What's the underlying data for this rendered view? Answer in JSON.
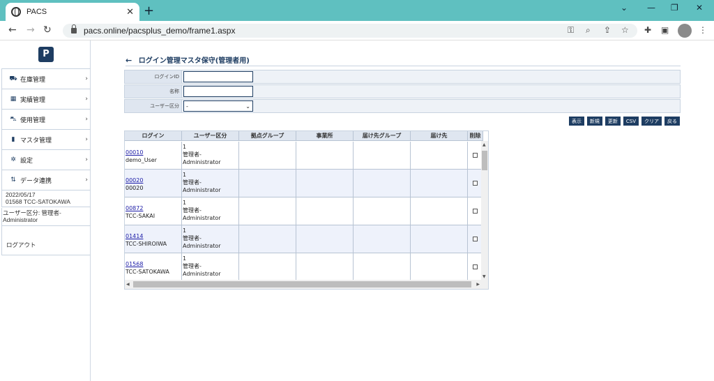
{
  "browser": {
    "tab_title": "PACS",
    "tab_close": "✕",
    "new_tab": "+",
    "url": "pacs.online/pacsplus_demo/frame1.aspx",
    "min": "⌄",
    "min2": "—",
    "restore": "❐",
    "close": "✕"
  },
  "sidebar": {
    "logo": "P",
    "items": [
      {
        "label": "在庫管理",
        "icon": "box-icon"
      },
      {
        "label": "実績管理",
        "icon": "table-icon"
      },
      {
        "label": "使用管理",
        "icon": "cart-icon"
      },
      {
        "label": "マスタ管理",
        "icon": "file-icon"
      },
      {
        "label": "設定",
        "icon": "gear-icon"
      },
      {
        "label": "データ連携",
        "icon": "sync-icon"
      }
    ],
    "date": "2022/05/17",
    "user": "01568 TCC-SATOKAWA",
    "user_type": "ユーザー区分: 管理者-Administrator",
    "logout": "ログアウト"
  },
  "page": {
    "title": "ログイン管理マスタ保守(管理者用)"
  },
  "form": {
    "login_id_label": "ログインID",
    "login_id_value": "",
    "name_label": "名称",
    "name_value": "",
    "user_type_label": "ユーザー区分",
    "user_type_value": "-"
  },
  "buttons": {
    "show": "表示",
    "new": "新規",
    "update": "更新",
    "csv": "CSV",
    "clear": "クリア",
    "back": "戻る"
  },
  "grid": {
    "headers": [
      "ログイン",
      "ユーザー区分",
      "拠点グループ",
      "事業所",
      "届け先グループ",
      "届け先",
      "削除"
    ],
    "rows": [
      {
        "id": "00010",
        "name": "demo_User",
        "type_code": "1",
        "type_name": "管理者-",
        "type_name2": "Administrator"
      },
      {
        "id": "00020",
        "name": "00020",
        "type_code": "1",
        "type_name": "管理者-",
        "type_name2": "Administrator"
      },
      {
        "id": "00872",
        "name": "TCC-SAKAI",
        "type_code": "1",
        "type_name": "管理者-",
        "type_name2": "Administrator"
      },
      {
        "id": "01414",
        "name": "TCC-SHIROIWA",
        "type_code": "1",
        "type_name": "管理者-",
        "type_name2": "Administrator"
      },
      {
        "id": "01568",
        "name": "TCC-SATOKAWA",
        "type_code": "1",
        "type_name": "管理者-",
        "type_name2": "Administrator"
      }
    ]
  }
}
